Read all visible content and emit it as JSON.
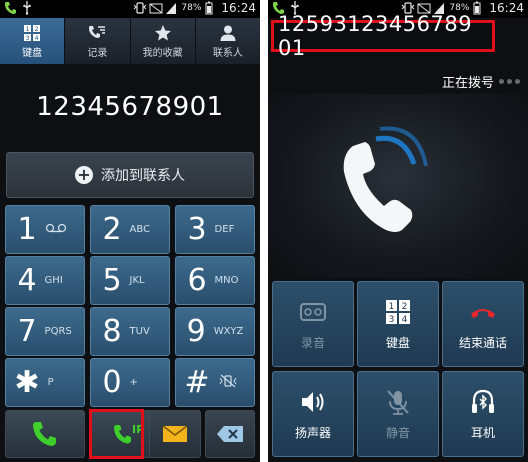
{
  "left_screen": {
    "status_bar": {
      "battery": "78%",
      "time": "16:24"
    },
    "tabs": [
      {
        "label": "键盘",
        "icon": "dialpad-icon",
        "active": true
      },
      {
        "label": "记录",
        "icon": "call-log-icon",
        "active": false
      },
      {
        "label": "我的收藏",
        "icon": "star-icon",
        "active": false
      },
      {
        "label": "联系人",
        "icon": "contact-icon",
        "active": false
      }
    ],
    "dialed_number": "12345678901",
    "add_contact_label": "添加到联系人",
    "keys": [
      {
        "digit": "1",
        "letters": ""
      },
      {
        "digit": "2",
        "letters": "ABC"
      },
      {
        "digit": "3",
        "letters": "DEF"
      },
      {
        "digit": "4",
        "letters": "GHI"
      },
      {
        "digit": "5",
        "letters": "JKL"
      },
      {
        "digit": "6",
        "letters": "MNO"
      },
      {
        "digit": "7",
        "letters": "PQRS"
      },
      {
        "digit": "8",
        "letters": "TUV"
      },
      {
        "digit": "9",
        "letters": "WXYZ"
      },
      {
        "digit": "✱",
        "letters": "P"
      },
      {
        "digit": "0",
        "letters": "+"
      },
      {
        "digit": "#",
        "letters": ""
      }
    ],
    "ip_call_label": "IP",
    "accent_color": "#3d6a8c",
    "highlight_color": "#e0101a"
  },
  "right_screen": {
    "status_bar": {
      "battery": "78%",
      "time": "16:24"
    },
    "dialed_number": "12593123456789​01",
    "call_status": "正在拨号",
    "buttons": [
      {
        "label": "录音",
        "icon": "record-icon",
        "enabled": false
      },
      {
        "label": "键盘",
        "icon": "dialpad-icon",
        "enabled": true
      },
      {
        "label": "结束通话",
        "icon": "end-call-icon",
        "enabled": true
      },
      {
        "label": "扬声器",
        "icon": "speaker-icon",
        "enabled": true
      },
      {
        "label": "静音",
        "icon": "mute-icon",
        "enabled": false
      },
      {
        "label": "耳机",
        "icon": "bluetooth-headset-icon",
        "enabled": true
      }
    ]
  }
}
